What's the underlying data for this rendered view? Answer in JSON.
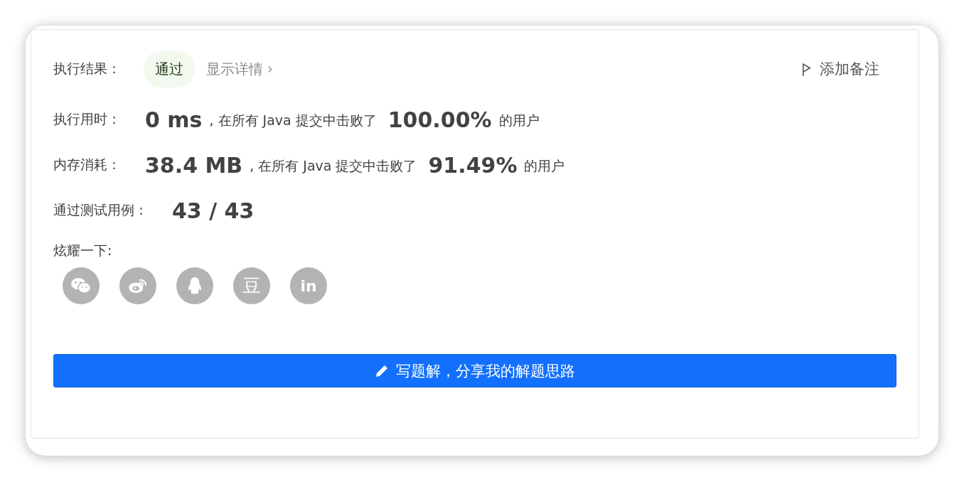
{
  "result": {
    "label": "执行结果：",
    "status": "通过",
    "details_link": "显示详情"
  },
  "note_button": "添加备注",
  "stats": [
    {
      "label": "执行用时：",
      "value": "0 ms",
      "text": ", 在所有 Java 提交中击败了",
      "percent": "100.00%",
      "suffix": "的用户"
    },
    {
      "label": "内存消耗：",
      "value": "38.4 MB",
      "text": ", 在所有 Java 提交中击败了",
      "percent": "91.49%",
      "suffix": "的用户"
    }
  ],
  "test_cases": {
    "label": "通过测试用例：",
    "value": "43 / 43"
  },
  "share": {
    "label": "炫耀一下:",
    "buttons": [
      {
        "kind": "wechat"
      },
      {
        "kind": "weibo"
      },
      {
        "kind": "qq"
      },
      {
        "kind": "douban",
        "glyph": "豆"
      },
      {
        "kind": "linkedin",
        "glyph": "in"
      }
    ]
  },
  "write_button": "写题解，分享我的解题思路"
}
